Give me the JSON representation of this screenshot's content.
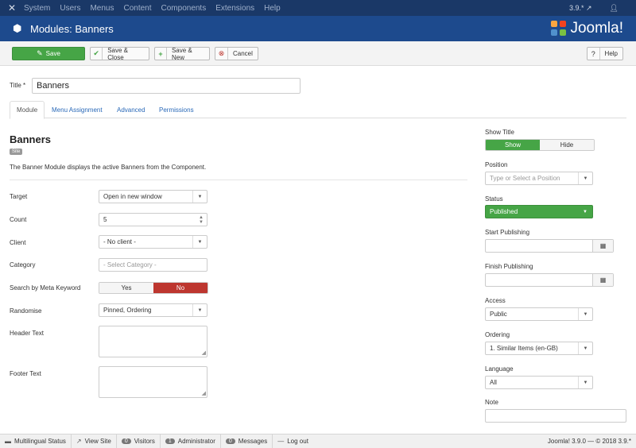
{
  "topnav": {
    "menu": [
      "System",
      "Users",
      "Menus",
      "Content",
      "Components",
      "Extensions",
      "Help"
    ],
    "version": "3.9.*"
  },
  "header": {
    "title": "Modules: Banners",
    "brand": "Joomla!"
  },
  "toolbar": {
    "save": "Save",
    "save_close": "Save & Close",
    "save_new": "Save & New",
    "cancel": "Cancel",
    "help": "Help"
  },
  "form": {
    "title_label": "Title",
    "title_value": "Banners"
  },
  "tabs": [
    "Module",
    "Menu Assignment",
    "Advanced",
    "Permissions"
  ],
  "module": {
    "name": "Banners",
    "badge": "Site",
    "description": "The Banner Module displays the active Banners from the Component."
  },
  "fields": {
    "target_label": "Target",
    "target_value": "Open in new window",
    "count_label": "Count",
    "count_value": "5",
    "client_label": "Client",
    "client_value": "- No client -",
    "category_label": "Category",
    "category_placeholder": "- Select Category -",
    "meta_label": "Search by Meta Keyword",
    "meta_yes": "Yes",
    "meta_no": "No",
    "randomise_label": "Randomise",
    "randomise_value": "Pinned, Ordering",
    "header_label": "Header Text",
    "footer_label": "Footer Text"
  },
  "side": {
    "show_title_label": "Show Title",
    "show_title_show": "Show",
    "show_title_hide": "Hide",
    "position_label": "Position",
    "position_placeholder": "Type or Select a Position",
    "status_label": "Status",
    "status_value": "Published",
    "start_label": "Start Publishing",
    "finish_label": "Finish Publishing",
    "access_label": "Access",
    "access_value": "Public",
    "ordering_label": "Ordering",
    "ordering_value": "1. Similar Items (en-GB)",
    "language_label": "Language",
    "language_value": "All",
    "note_label": "Note"
  },
  "statusbar": {
    "multilingual": "Multilingual Status",
    "view_site": "View Site",
    "visitors_count": "0",
    "visitors": "Visitors",
    "admin_count": "1",
    "admin": "Administrator",
    "messages_count": "0",
    "messages": "Messages",
    "logout": "Log out",
    "footer": "Joomla! 3.9.0  —  © 2018 3.9.*"
  },
  "colors": {
    "topnav": "#1a3867",
    "header": "#1d4a8d",
    "success": "#46a546",
    "danger": "#bd362f",
    "link": "#2a69b8"
  }
}
